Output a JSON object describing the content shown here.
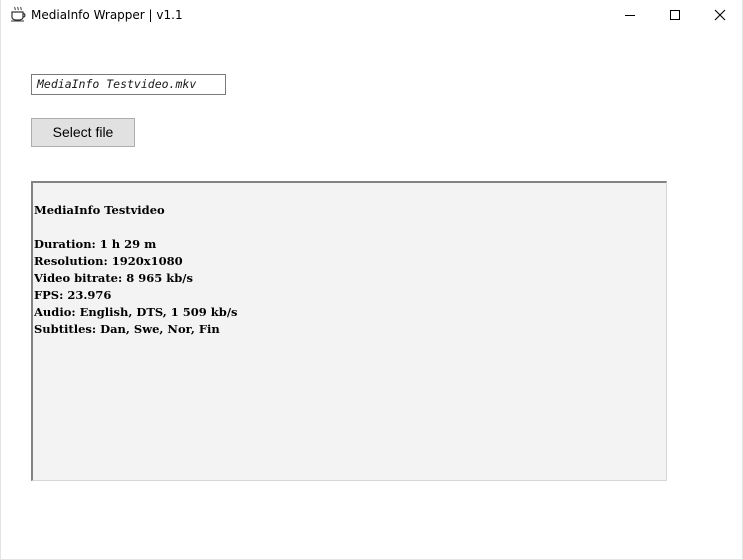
{
  "window": {
    "title": "MediaInfo Wrapper | v1.1",
    "icon": "coffee-cup-icon",
    "controls": {
      "minimize_icon": "minimize-icon",
      "maximize_icon": "maximize-icon",
      "close_icon": "close-icon"
    }
  },
  "file": {
    "selected_name": "MediaInfo Testvideo.mkv",
    "select_button_label": "Select file"
  },
  "info": {
    "heading": "MediaInfo Testvideo",
    "lines": [
      "Duration: 1 h 29 m",
      "Resolution: 1920x1080",
      "Video bitrate: 8 965 kb/s",
      "FPS: 23.976",
      "Audio: English, DTS, 1 509 kb/s",
      "Subtitles: Dan, Swe, Nor, Fin"
    ]
  },
  "colors": {
    "button_background": "#e1e1e1",
    "panel_background": "#f3f3f3"
  }
}
